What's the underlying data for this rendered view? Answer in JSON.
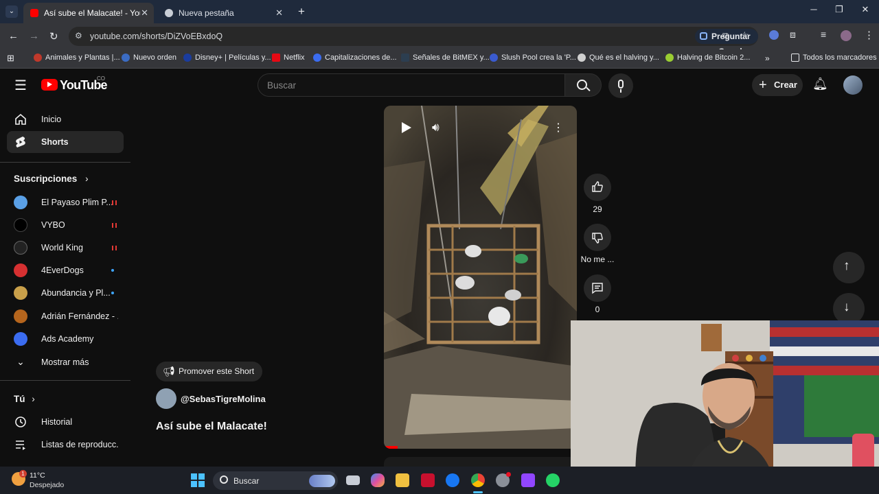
{
  "browser": {
    "tabs": [
      {
        "title": "Así sube el Malacate! - YouTube",
        "active": true
      },
      {
        "title": "Nueva pestaña",
        "active": false
      }
    ],
    "url": "youtube.com/shorts/DiZVoEBxdoQ",
    "ask_google": "Preguntar a Google",
    "bookmarks": [
      {
        "label": "Animales y Plantas |...",
        "color": "#c0392b"
      },
      {
        "label": "Nuevo orden",
        "color": "#3b6cc4"
      },
      {
        "label": "Disney+ | Películas y...",
        "color": "#1a3c9e"
      },
      {
        "label": "Netflix",
        "color": "#e50914"
      },
      {
        "label": "Capitalizaciones de...",
        "color": "#3b6cf0"
      },
      {
        "label": "Señales de BitMEX y...",
        "color": "#2c3e50"
      },
      {
        "label": "Slush Pool crea la 'P...",
        "color": "#3a5bd0"
      },
      {
        "label": "Qué es el halving y...",
        "color": "#d0d0d0"
      },
      {
        "label": "Halving de Bitcoin 2...",
        "color": "#9acd32"
      }
    ],
    "all_bookmarks": "Todos los marcadores"
  },
  "youtube": {
    "logo": "YouTube",
    "country": "CO",
    "search_placeholder": "Buscar",
    "create_label": "Crear"
  },
  "sidebar": {
    "main": [
      {
        "label": "Inicio",
        "icon": "home-icon"
      },
      {
        "label": "Shorts",
        "icon": "shorts-icon",
        "active": true
      }
    ],
    "subs_title": "Suscripciones",
    "subscriptions": [
      {
        "label": "El Payaso Plim P...",
        "color": "#5aa0e6",
        "status": "live"
      },
      {
        "label": "VYBO",
        "color": "#000000",
        "status": "live"
      },
      {
        "label": "World King",
        "color": "#222222",
        "status": "live"
      },
      {
        "label": "4EverDogs",
        "color": "#d63031",
        "status": "new"
      },
      {
        "label": "Abundancia y Pl...",
        "color": "#c9a04a",
        "status": "new"
      },
      {
        "label": "Adrián Fernández - ...",
        "color": "#b5651d",
        "status": "none"
      },
      {
        "label": "Ads Academy",
        "color": "#3b6cf0",
        "status": "none"
      }
    ],
    "show_more": "Mostrar más",
    "you_title": "Tú",
    "you": [
      {
        "label": "Historial",
        "icon": "history-icon"
      },
      {
        "label": "Listas de reproducc...",
        "icon": "playlists-icon"
      }
    ]
  },
  "short": {
    "likes": "29",
    "dislike_label": "No me ...",
    "comments": "0",
    "promote_label": "Promover este Short",
    "channel": "@SebasTigreMolina",
    "title": "Así sube el Malacate!"
  },
  "taskbar": {
    "temperature": "11°C",
    "weather": "Despejado",
    "search": "Buscar"
  }
}
